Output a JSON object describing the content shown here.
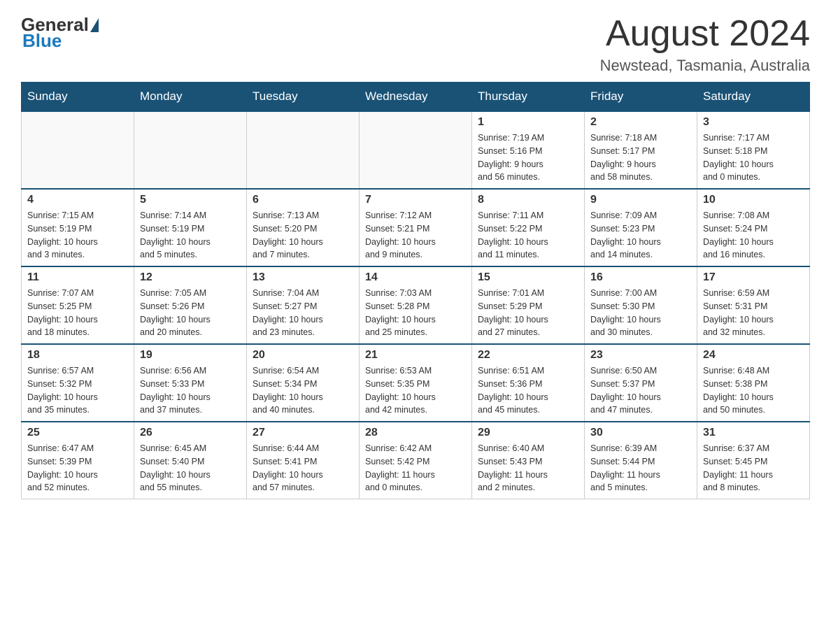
{
  "header": {
    "logo_general": "General",
    "logo_blue": "Blue",
    "month_title": "August 2024",
    "location": "Newstead, Tasmania, Australia"
  },
  "days_of_week": [
    "Sunday",
    "Monday",
    "Tuesday",
    "Wednesday",
    "Thursday",
    "Friday",
    "Saturday"
  ],
  "weeks": [
    [
      {
        "day": "",
        "info": ""
      },
      {
        "day": "",
        "info": ""
      },
      {
        "day": "",
        "info": ""
      },
      {
        "day": "",
        "info": ""
      },
      {
        "day": "1",
        "info": "Sunrise: 7:19 AM\nSunset: 5:16 PM\nDaylight: 9 hours\nand 56 minutes."
      },
      {
        "day": "2",
        "info": "Sunrise: 7:18 AM\nSunset: 5:17 PM\nDaylight: 9 hours\nand 58 minutes."
      },
      {
        "day": "3",
        "info": "Sunrise: 7:17 AM\nSunset: 5:18 PM\nDaylight: 10 hours\nand 0 minutes."
      }
    ],
    [
      {
        "day": "4",
        "info": "Sunrise: 7:15 AM\nSunset: 5:19 PM\nDaylight: 10 hours\nand 3 minutes."
      },
      {
        "day": "5",
        "info": "Sunrise: 7:14 AM\nSunset: 5:19 PM\nDaylight: 10 hours\nand 5 minutes."
      },
      {
        "day": "6",
        "info": "Sunrise: 7:13 AM\nSunset: 5:20 PM\nDaylight: 10 hours\nand 7 minutes."
      },
      {
        "day": "7",
        "info": "Sunrise: 7:12 AM\nSunset: 5:21 PM\nDaylight: 10 hours\nand 9 minutes."
      },
      {
        "day": "8",
        "info": "Sunrise: 7:11 AM\nSunset: 5:22 PM\nDaylight: 10 hours\nand 11 minutes."
      },
      {
        "day": "9",
        "info": "Sunrise: 7:09 AM\nSunset: 5:23 PM\nDaylight: 10 hours\nand 14 minutes."
      },
      {
        "day": "10",
        "info": "Sunrise: 7:08 AM\nSunset: 5:24 PM\nDaylight: 10 hours\nand 16 minutes."
      }
    ],
    [
      {
        "day": "11",
        "info": "Sunrise: 7:07 AM\nSunset: 5:25 PM\nDaylight: 10 hours\nand 18 minutes."
      },
      {
        "day": "12",
        "info": "Sunrise: 7:05 AM\nSunset: 5:26 PM\nDaylight: 10 hours\nand 20 minutes."
      },
      {
        "day": "13",
        "info": "Sunrise: 7:04 AM\nSunset: 5:27 PM\nDaylight: 10 hours\nand 23 minutes."
      },
      {
        "day": "14",
        "info": "Sunrise: 7:03 AM\nSunset: 5:28 PM\nDaylight: 10 hours\nand 25 minutes."
      },
      {
        "day": "15",
        "info": "Sunrise: 7:01 AM\nSunset: 5:29 PM\nDaylight: 10 hours\nand 27 minutes."
      },
      {
        "day": "16",
        "info": "Sunrise: 7:00 AM\nSunset: 5:30 PM\nDaylight: 10 hours\nand 30 minutes."
      },
      {
        "day": "17",
        "info": "Sunrise: 6:59 AM\nSunset: 5:31 PM\nDaylight: 10 hours\nand 32 minutes."
      }
    ],
    [
      {
        "day": "18",
        "info": "Sunrise: 6:57 AM\nSunset: 5:32 PM\nDaylight: 10 hours\nand 35 minutes."
      },
      {
        "day": "19",
        "info": "Sunrise: 6:56 AM\nSunset: 5:33 PM\nDaylight: 10 hours\nand 37 minutes."
      },
      {
        "day": "20",
        "info": "Sunrise: 6:54 AM\nSunset: 5:34 PM\nDaylight: 10 hours\nand 40 minutes."
      },
      {
        "day": "21",
        "info": "Sunrise: 6:53 AM\nSunset: 5:35 PM\nDaylight: 10 hours\nand 42 minutes."
      },
      {
        "day": "22",
        "info": "Sunrise: 6:51 AM\nSunset: 5:36 PM\nDaylight: 10 hours\nand 45 minutes."
      },
      {
        "day": "23",
        "info": "Sunrise: 6:50 AM\nSunset: 5:37 PM\nDaylight: 10 hours\nand 47 minutes."
      },
      {
        "day": "24",
        "info": "Sunrise: 6:48 AM\nSunset: 5:38 PM\nDaylight: 10 hours\nand 50 minutes."
      }
    ],
    [
      {
        "day": "25",
        "info": "Sunrise: 6:47 AM\nSunset: 5:39 PM\nDaylight: 10 hours\nand 52 minutes."
      },
      {
        "day": "26",
        "info": "Sunrise: 6:45 AM\nSunset: 5:40 PM\nDaylight: 10 hours\nand 55 minutes."
      },
      {
        "day": "27",
        "info": "Sunrise: 6:44 AM\nSunset: 5:41 PM\nDaylight: 10 hours\nand 57 minutes."
      },
      {
        "day": "28",
        "info": "Sunrise: 6:42 AM\nSunset: 5:42 PM\nDaylight: 11 hours\nand 0 minutes."
      },
      {
        "day": "29",
        "info": "Sunrise: 6:40 AM\nSunset: 5:43 PM\nDaylight: 11 hours\nand 2 minutes."
      },
      {
        "day": "30",
        "info": "Sunrise: 6:39 AM\nSunset: 5:44 PM\nDaylight: 11 hours\nand 5 minutes."
      },
      {
        "day": "31",
        "info": "Sunrise: 6:37 AM\nSunset: 5:45 PM\nDaylight: 11 hours\nand 8 minutes."
      }
    ]
  ]
}
